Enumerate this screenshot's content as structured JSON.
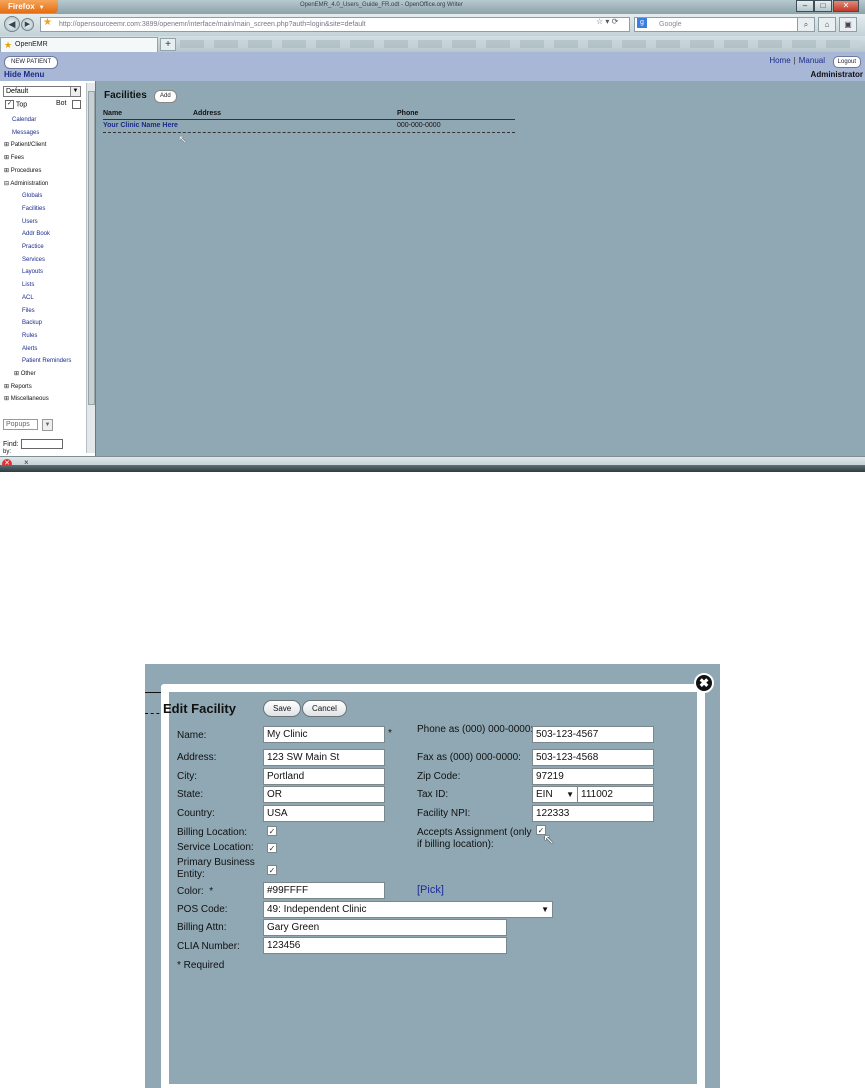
{
  "browser": {
    "button_label": "Firefox",
    "window_title": "OpenEMR_4.0_Users_Guide_FR.odt - OpenOffice.org Writer",
    "url": "http://opensourceemr.com:3899/openemr/interface/main/main_screen.php?auth=login&site=default",
    "search_placeholder": "Google",
    "tab_label": "OpenEMR",
    "new_tab": "+"
  },
  "header": {
    "new_patient": "NEW PATIENT",
    "hide_menu": "Hide Menu",
    "home": "Home",
    "separator": "|",
    "manual": "Manual",
    "logout": "Logout",
    "user": "Administrator"
  },
  "leftnav": {
    "menu_select": "Default",
    "top_label": "Top",
    "bot_label": "Bot",
    "items": [
      {
        "label": "Calendar"
      },
      {
        "label": "Messages"
      },
      {
        "label": "Patient/Client"
      },
      {
        "label": "Fees"
      },
      {
        "label": "Procedures"
      },
      {
        "label": "Administration"
      },
      {
        "label": "Globals"
      },
      {
        "label": "Facilities"
      },
      {
        "label": "Users"
      },
      {
        "label": "Addr Book"
      },
      {
        "label": "Practice"
      },
      {
        "label": "Services"
      },
      {
        "label": "Layouts"
      },
      {
        "label": "Lists"
      },
      {
        "label": "ACL"
      },
      {
        "label": "Files"
      },
      {
        "label": "Backup"
      },
      {
        "label": "Rules"
      },
      {
        "label": "Alerts"
      },
      {
        "label": "Patient Reminders"
      },
      {
        "label": "Other"
      },
      {
        "label": "Reports"
      },
      {
        "label": "Miscellaneous"
      }
    ],
    "popups": "Popups",
    "find_label": "Find:",
    "by_label": "by:"
  },
  "facilities": {
    "title": "Facilities",
    "add_button": "Add",
    "columns": [
      "Name",
      "Address",
      "Phone"
    ],
    "rows": [
      {
        "name": "Your Clinic Name Here",
        "address": "",
        "phone": "000-000-0000"
      }
    ]
  },
  "edit_facility": {
    "title": "Edit Facility",
    "save": "Save",
    "cancel": "Cancel",
    "close_icon": "✖",
    "labels": {
      "name": "Name:",
      "address": "Address:",
      "city": "City:",
      "state": "State:",
      "country": "Country:",
      "billing_location": "Billing Location:",
      "service_location": "Service Location:",
      "primary_business": "Primary Business Entity:",
      "color": "Color:",
      "pos_code": "POS Code:",
      "billing_attn": "Billing Attn:",
      "clia": "CLIA Number:",
      "phone": "Phone as (000) 000-0000:",
      "fax": "Fax as (000) 000-0000:",
      "zip": "Zip Code:",
      "tax_id": "Tax ID:",
      "npi": "Facility NPI:",
      "accepts_assignment": "Accepts Assignment (only if billing location):",
      "required_note": "* Required",
      "asterisk": "*",
      "pick": "[Pick]"
    },
    "values": {
      "name": "My Clinic",
      "address": "123 SW Main St",
      "city": "Portland",
      "state": "OR",
      "country": "USA",
      "color": "#99FFFF",
      "pos_code": "49: Independent Clinic",
      "billing_attn": "Gary Green",
      "clia": "123456",
      "phone": "503-123-4567",
      "fax": "503-123-4568",
      "zip": "97219",
      "tax_id_type": "EIN",
      "tax_id": "111002",
      "npi": "122333"
    },
    "checks": {
      "billing_location": true,
      "service_location": true,
      "primary_business": true,
      "accepts_assignment": true
    }
  },
  "colors": {
    "content_bg": "#8fa8b4",
    "header_bg": "#a8b7d6",
    "link": "#1c2b8a"
  }
}
